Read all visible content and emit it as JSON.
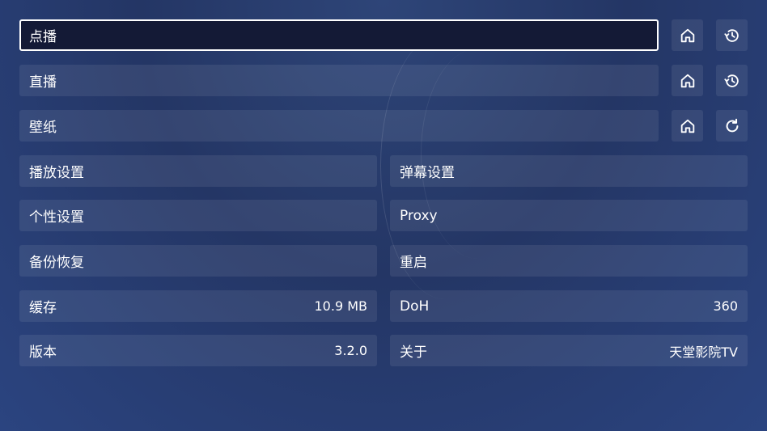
{
  "top_rows": [
    {
      "label": "点播",
      "icons": [
        "home-icon",
        "history-icon"
      ]
    },
    {
      "label": "直播",
      "icons": [
        "home-icon",
        "history-icon"
      ]
    },
    {
      "label": "壁纸",
      "icons": [
        "home-icon",
        "refresh-icon"
      ]
    }
  ],
  "left": [
    {
      "label": "播放设置",
      "value": ""
    },
    {
      "label": "个性设置",
      "value": ""
    },
    {
      "label": "备份恢复",
      "value": ""
    },
    {
      "label": "缓存",
      "value": "10.9 MB"
    },
    {
      "label": "版本",
      "value": "3.2.0"
    }
  ],
  "right": [
    {
      "label": "弹幕设置",
      "value": ""
    },
    {
      "label": "Proxy",
      "value": ""
    },
    {
      "label": "重启",
      "value": ""
    },
    {
      "label": "DoH",
      "value": "360"
    },
    {
      "label": "关于",
      "value": "天堂影院TV"
    }
  ]
}
